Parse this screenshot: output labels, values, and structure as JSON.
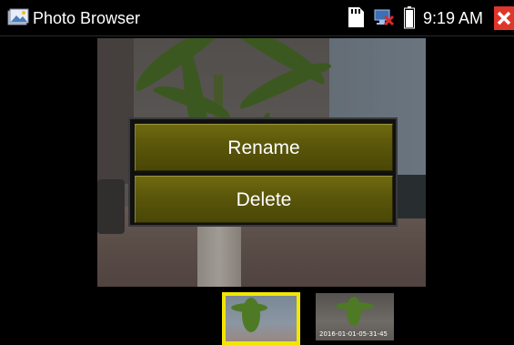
{
  "titlebar": {
    "app_title": "Photo Browser",
    "app_icon": "photo-browser-icon",
    "time": "9:19 AM",
    "status_icons": [
      "sd-card-icon",
      "network-error-icon",
      "battery-icon"
    ],
    "close_icon": "close-icon",
    "close_color": "#e0352b"
  },
  "context_menu": {
    "items": [
      {
        "label": "Rename"
      },
      {
        "label": "Delete"
      }
    ],
    "item_color": "#5a560a"
  },
  "thumbnails": {
    "selected_border_color": "#f2e600",
    "items": [
      {
        "stamp": "",
        "selected": true
      },
      {
        "stamp": "2016-01-01-05-31-45",
        "selected": false
      }
    ]
  }
}
